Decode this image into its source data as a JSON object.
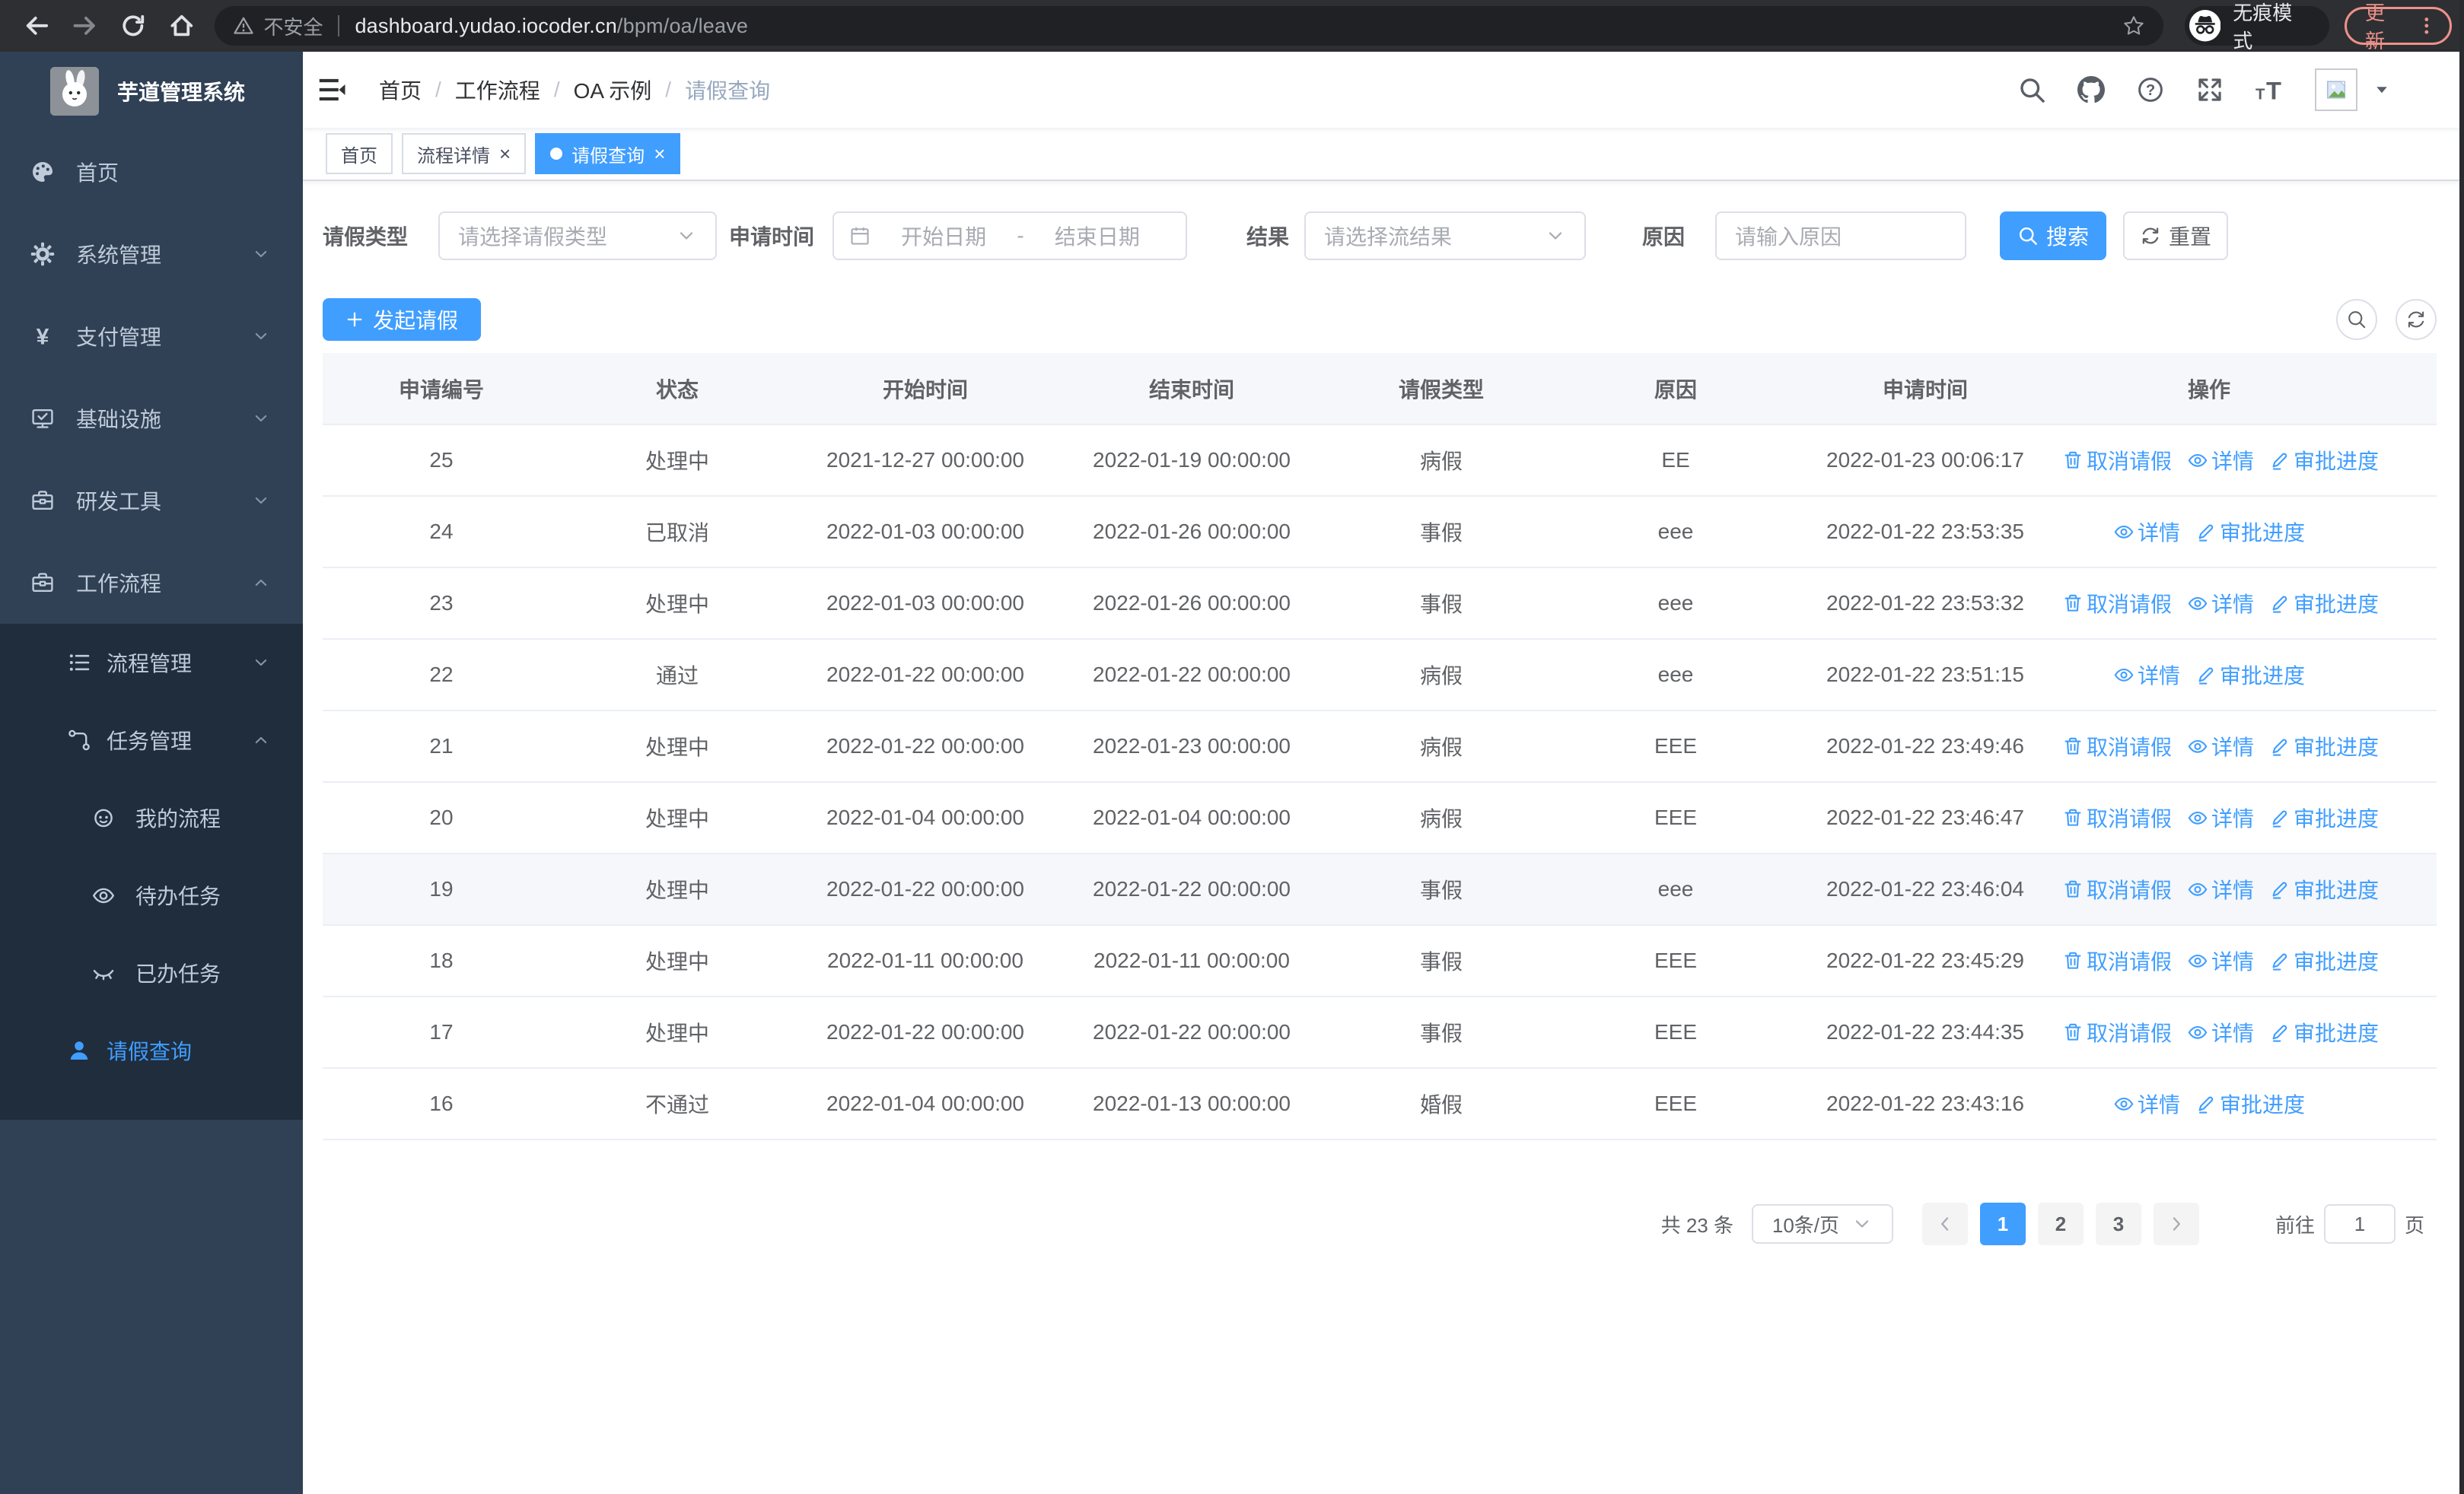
{
  "browser": {
    "security_label": "不安全",
    "url_domain": "dashboard.yudao.iocoder.cn",
    "url_path": "/bpm/oa/leave",
    "incognito_label": "无痕模式",
    "update_label": "更新"
  },
  "sidebar": {
    "title": "芋道管理系统",
    "menu": [
      {
        "label": "首页",
        "icon": "dashboard-icon",
        "level": 0
      },
      {
        "label": "系统管理",
        "icon": "gear-icon",
        "level": 0,
        "arrow": "down"
      },
      {
        "label": "支付管理",
        "icon": "yen-icon",
        "level": 0,
        "arrow": "down"
      },
      {
        "label": "基础设施",
        "icon": "monitor-check-icon",
        "level": 0,
        "arrow": "down"
      },
      {
        "label": "研发工具",
        "icon": "toolbox-icon",
        "level": 0,
        "arrow": "down"
      },
      {
        "label": "工作流程",
        "icon": "workflow-box-icon",
        "level": 0,
        "arrow": "up"
      },
      {
        "label": "流程管理",
        "icon": "list-tree-icon",
        "level": 1,
        "arrow": "down",
        "sub": true
      },
      {
        "label": "任务管理",
        "icon": "flow-branch-icon",
        "level": 1,
        "arrow": "up",
        "sub": true
      },
      {
        "label": "我的流程",
        "icon": "robot-face-icon",
        "level": 2,
        "sub": true
      },
      {
        "label": "待办任务",
        "icon": "eye-open-icon",
        "level": 2,
        "sub": true
      },
      {
        "label": "已办任务",
        "icon": "eye-closed-icon",
        "level": 2,
        "sub": true
      },
      {
        "label": "请假查询",
        "icon": "user-icon",
        "level": 1,
        "sub": true,
        "active": true
      }
    ]
  },
  "header": {
    "breadcrumb": [
      {
        "label": "首页"
      },
      {
        "label": "工作流程"
      },
      {
        "label": "OA 示例"
      },
      {
        "label": "请假查询",
        "current": true
      }
    ]
  },
  "tabs": [
    {
      "label": "首页"
    },
    {
      "label": "流程详情",
      "closable": true
    },
    {
      "label": "请假查询",
      "closable": true,
      "active": true
    }
  ],
  "filters": {
    "leave_type_label": "请假类型",
    "leave_type_placeholder": "请选择请假类型",
    "apply_time_label": "申请时间",
    "date_start_placeholder": "开始日期",
    "date_separator": "-",
    "date_end_placeholder": "结束日期",
    "result_label": "结果",
    "result_placeholder": "请选择流结果",
    "reason_label": "原因",
    "reason_placeholder": "请输入原因",
    "search_label": "搜索",
    "reset_label": "重置"
  },
  "toolbar": {
    "create_label": "发起请假"
  },
  "table": {
    "columns": [
      "申请编号",
      "状态",
      "开始时间",
      "结束时间",
      "请假类型",
      "原因",
      "申请时间",
      "操作"
    ],
    "action_labels": {
      "cancel": "取消请假",
      "detail": "详情",
      "progress": "审批进度"
    },
    "rows": [
      {
        "id": "25",
        "status": "处理中",
        "start": "2021-12-27 00:00:00",
        "end": "2022-01-19 00:00:00",
        "type": "病假",
        "reason": "EE",
        "applied": "2022-01-23 00:06:17",
        "actions": [
          "cancel",
          "detail",
          "progress"
        ]
      },
      {
        "id": "24",
        "status": "已取消",
        "start": "2022-01-03 00:00:00",
        "end": "2022-01-26 00:00:00",
        "type": "事假",
        "reason": "eee",
        "applied": "2022-01-22 23:53:35",
        "actions": [
          "detail",
          "progress"
        ]
      },
      {
        "id": "23",
        "status": "处理中",
        "start": "2022-01-03 00:00:00",
        "end": "2022-01-26 00:00:00",
        "type": "事假",
        "reason": "eee",
        "applied": "2022-01-22 23:53:32",
        "actions": [
          "cancel",
          "detail",
          "progress"
        ]
      },
      {
        "id": "22",
        "status": "通过",
        "start": "2022-01-22 00:00:00",
        "end": "2022-01-22 00:00:00",
        "type": "病假",
        "reason": "eee",
        "applied": "2022-01-22 23:51:15",
        "actions": [
          "detail",
          "progress"
        ]
      },
      {
        "id": "21",
        "status": "处理中",
        "start": "2022-01-22 00:00:00",
        "end": "2022-01-23 00:00:00",
        "type": "病假",
        "reason": "EEE",
        "applied": "2022-01-22 23:49:46",
        "actions": [
          "cancel",
          "detail",
          "progress"
        ]
      },
      {
        "id": "20",
        "status": "处理中",
        "start": "2022-01-04 00:00:00",
        "end": "2022-01-04 00:00:00",
        "type": "病假",
        "reason": "EEE",
        "applied": "2022-01-22 23:46:47",
        "actions": [
          "cancel",
          "detail",
          "progress"
        ]
      },
      {
        "id": "19",
        "status": "处理中",
        "start": "2022-01-22 00:00:00",
        "end": "2022-01-22 00:00:00",
        "type": "事假",
        "reason": "eee",
        "applied": "2022-01-22 23:46:04",
        "actions": [
          "cancel",
          "detail",
          "progress"
        ],
        "highlighted": true
      },
      {
        "id": "18",
        "status": "处理中",
        "start": "2022-01-11 00:00:00",
        "end": "2022-01-11 00:00:00",
        "type": "事假",
        "reason": "EEE",
        "applied": "2022-01-22 23:45:29",
        "actions": [
          "cancel",
          "detail",
          "progress"
        ]
      },
      {
        "id": "17",
        "status": "处理中",
        "start": "2022-01-22 00:00:00",
        "end": "2022-01-22 00:00:00",
        "type": "事假",
        "reason": "EEE",
        "applied": "2022-01-22 23:44:35",
        "actions": [
          "cancel",
          "detail",
          "progress"
        ]
      },
      {
        "id": "16",
        "status": "不通过",
        "start": "2022-01-04 00:00:00",
        "end": "2022-01-13 00:00:00",
        "type": "婚假",
        "reason": "EEE",
        "applied": "2022-01-22 23:43:16",
        "actions": [
          "detail",
          "progress"
        ]
      }
    ]
  },
  "pagination": {
    "total_label": "共 23 条",
    "page_size_label": "10条/页",
    "pages": [
      "1",
      "2",
      "3"
    ],
    "active_page": "1",
    "goto_label": "前往",
    "goto_value": "1",
    "page_unit_label": "页"
  },
  "colors": {
    "primary": "#409eff"
  }
}
